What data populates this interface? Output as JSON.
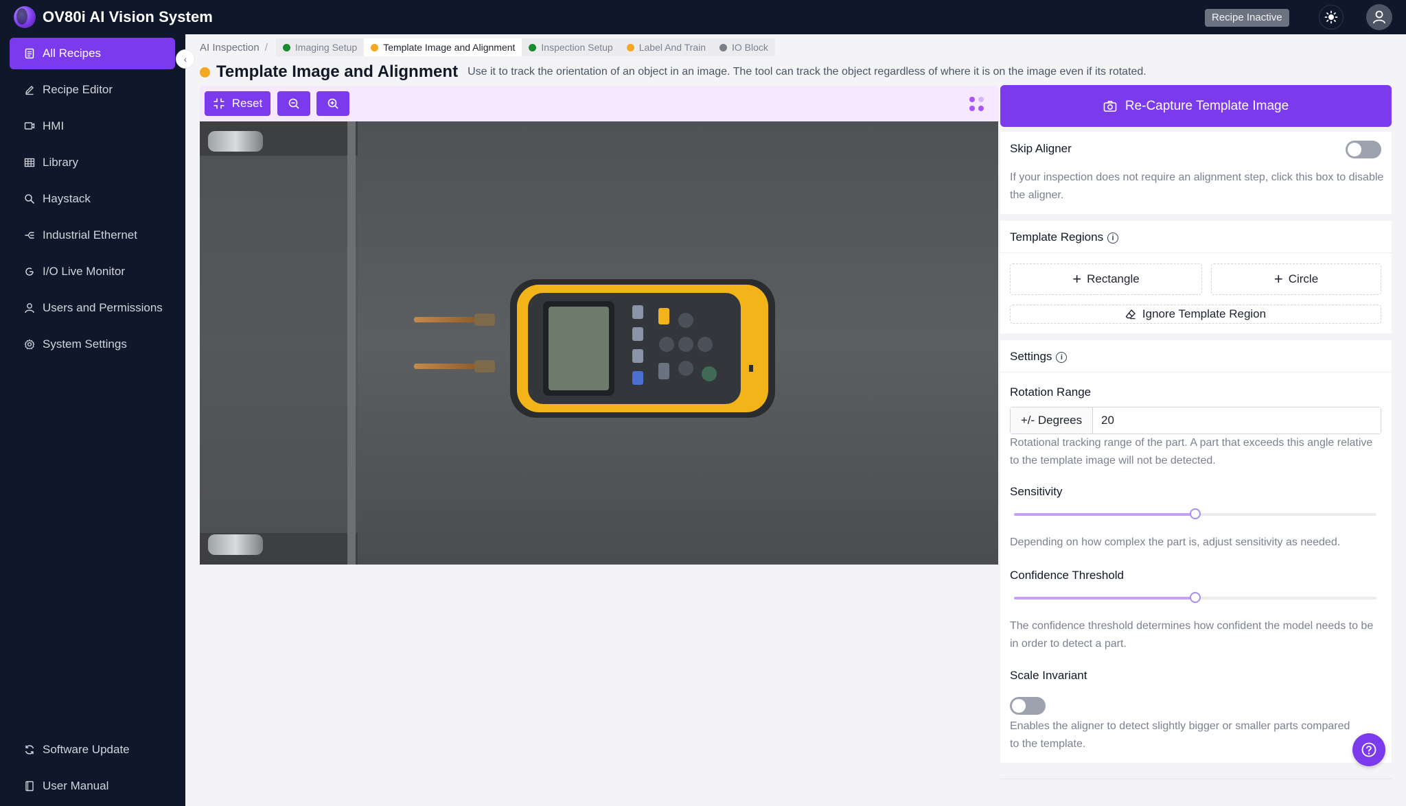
{
  "app": {
    "title": "OV80i AI Vision System",
    "recipe_status": "Recipe Inactive"
  },
  "sidebar": {
    "items": [
      {
        "label": "All Recipes",
        "icon": "document-list-icon",
        "active": true
      },
      {
        "label": "Recipe Editor",
        "icon": "pencil-icon"
      },
      {
        "label": "HMI",
        "icon": "monitor-icon"
      },
      {
        "label": "Library",
        "icon": "grid-icon"
      },
      {
        "label": "Haystack",
        "icon": "search-icon"
      },
      {
        "label": "Industrial Ethernet",
        "icon": "network-icon"
      },
      {
        "label": "I/O Live Monitor",
        "icon": "refresh-icon"
      },
      {
        "label": "Users and Permissions",
        "icon": "user-icon"
      },
      {
        "label": "System Settings",
        "icon": "gear-icon"
      }
    ],
    "footer": [
      {
        "label": "Software Update",
        "icon": "sync-icon"
      },
      {
        "label": "User Manual",
        "icon": "book-icon"
      }
    ]
  },
  "breadcrumb": {
    "root": "AI Inspection",
    "separator": "/",
    "tabs": [
      {
        "label": "Imaging Setup",
        "color": "#1a8a2e"
      },
      {
        "label": "Template Image and Alignment",
        "color": "#f5a623",
        "current": true
      },
      {
        "label": "Inspection Setup",
        "color": "#1a8a2e"
      },
      {
        "label": "Label And Train",
        "color": "#f5a623"
      },
      {
        "label": "IO Block",
        "color": "#7b7f88"
      }
    ]
  },
  "page": {
    "title": "Template Image and Alignment",
    "description": "Use it to track the orientation of an object in an image. The tool can track the object regardless of where it is on the image even if its rotated."
  },
  "toolbar": {
    "reset_label": "Reset"
  },
  "panel": {
    "recapture_label": "Re-Capture Template Image",
    "skip_aligner": {
      "label": "Skip Aligner",
      "enabled": false,
      "help": "If your inspection does not require an alignment step, click this box to disable the aligner."
    },
    "template_regions": {
      "title": "Template Regions",
      "rectangle_label": "Rectangle",
      "circle_label": "Circle",
      "ignore_label": "Ignore Template Region"
    },
    "settings": {
      "title": "Settings",
      "rotation": {
        "label": "Rotation Range",
        "addon": "+/- Degrees",
        "value": "20",
        "help": "Rotational tracking range of the part. A part that exceeds this angle relative to the template image will not be detected."
      },
      "sensitivity": {
        "label": "Sensitivity",
        "value_fraction": 0.5,
        "help": "Depending on how complex the part is, adjust sensitivity as needed."
      },
      "confidence": {
        "label": "Confidence Threshold",
        "value_fraction": 0.5,
        "help": "The confidence threshold determines how confident the model needs to be in order to detect a part."
      },
      "scale_invariant": {
        "label": "Scale Invariant",
        "enabled": false,
        "help": "Enables the aligner to detect slightly bigger or smaller parts compared to the template."
      }
    }
  },
  "colors": {
    "accent": "#7c3aed",
    "sidebar_bg": "#0f172a",
    "status_amber": "#f5a623",
    "status_green": "#1a8a2e"
  }
}
